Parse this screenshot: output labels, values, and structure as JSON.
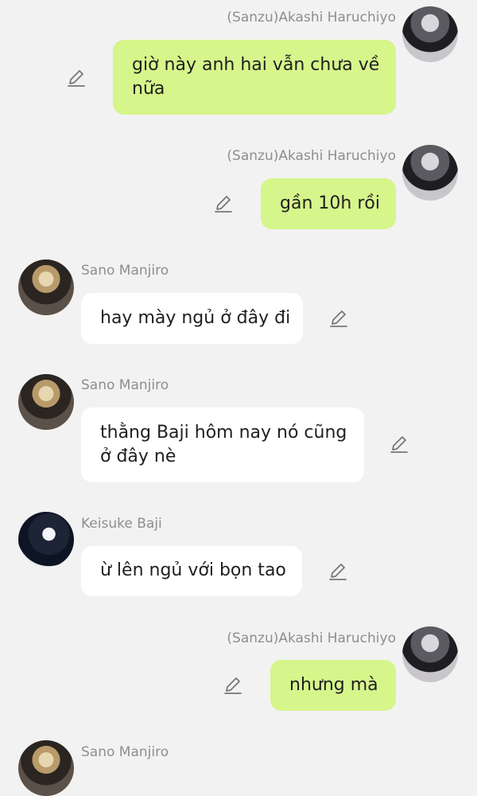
{
  "messages": [
    {
      "sender": "(Sanzu)Akashi Haruchiyo",
      "text": "giờ này anh hai vẫn chưa về nữa",
      "direction": "outgoing"
    },
    {
      "sender": "(Sanzu)Akashi Haruchiyo",
      "text": "gần 10h rồi",
      "direction": "outgoing"
    },
    {
      "sender": "Sano Manjiro",
      "text": "hay mày ngủ ở đây đi",
      "direction": "incoming"
    },
    {
      "sender": "Sano Manjiro",
      "text": "thằng Baji hôm nay nó cũng ở đây nè",
      "direction": "incoming"
    },
    {
      "sender": "Keisuke Baji",
      "text": "ừ lên ngủ với bọn tao",
      "direction": "incoming"
    },
    {
      "sender": "(Sanzu)Akashi Haruchiyo",
      "text": "nhưng mà",
      "direction": "outgoing"
    },
    {
      "sender": "Sano Manjiro",
      "text": "",
      "direction": "incoming"
    }
  ],
  "icons": {
    "edit": "pencil-edit-icon"
  },
  "colors": {
    "background": "#f2f2f2",
    "outgoing_bubble": "#d6f58b",
    "incoming_bubble": "#ffffff",
    "sender_name": "#8e8e8e"
  }
}
